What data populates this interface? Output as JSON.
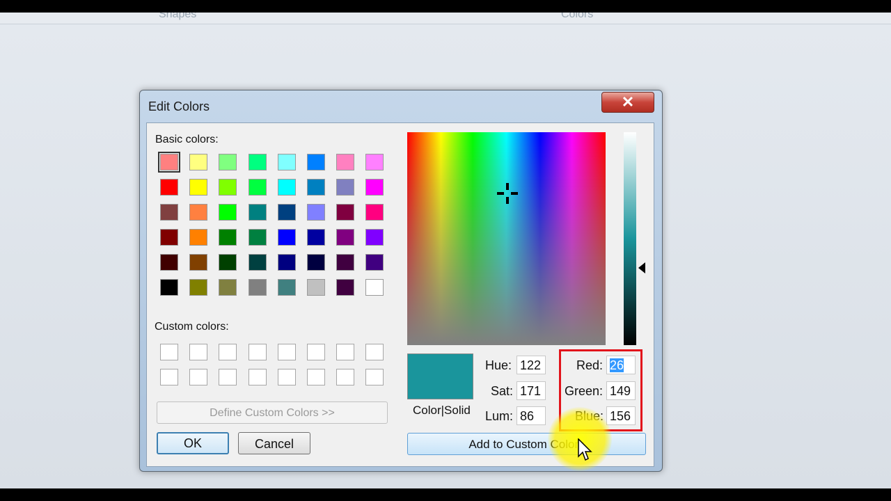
{
  "background": {
    "ribbon_left": "Shapes",
    "ribbon_right": "Colors"
  },
  "dialog": {
    "title": "Edit Colors",
    "close_label": "✕",
    "basic_colors_label": "Basic colors:",
    "custom_colors_label": "Custom colors:",
    "define_custom_label": "Define Custom Colors >>",
    "ok_label": "OK",
    "cancel_label": "Cancel",
    "color_solid_label": "Color|Solid",
    "hue_label": "Hue:",
    "hue_value": "122",
    "sat_label": "Sat:",
    "sat_value": "171",
    "lum_label": "Lum:",
    "lum_value": "86",
    "red_label": "Red:",
    "red_value": "26",
    "green_label": "Green:",
    "green_value": "149",
    "blue_label": "Blue:",
    "blue_value": "156",
    "add_custom_label": "Add to Custom Colors",
    "current_color": "#1a959c"
  },
  "basic_colors": [
    [
      "#ff8080",
      "#ffff80",
      "#80ff80",
      "#00ff80",
      "#80ffff",
      "#0080ff",
      "#ff80c0",
      "#ff80ff"
    ],
    [
      "#ff0000",
      "#ffff00",
      "#80ff00",
      "#00ff40",
      "#00ffff",
      "#0080c0",
      "#8080c0",
      "#ff00ff"
    ],
    [
      "#804040",
      "#ff8040",
      "#00ff00",
      "#008080",
      "#004080",
      "#8080ff",
      "#800040",
      "#ff0080"
    ],
    [
      "#800000",
      "#ff8000",
      "#008000",
      "#008040",
      "#0000ff",
      "#0000a0",
      "#800080",
      "#8000ff"
    ],
    [
      "#400000",
      "#804000",
      "#004000",
      "#004040",
      "#000080",
      "#000040",
      "#400040",
      "#400080"
    ],
    [
      "#000000",
      "#808000",
      "#808040",
      "#808080",
      "#408080",
      "#c0c0c0",
      "#400040",
      "#ffffff"
    ]
  ]
}
